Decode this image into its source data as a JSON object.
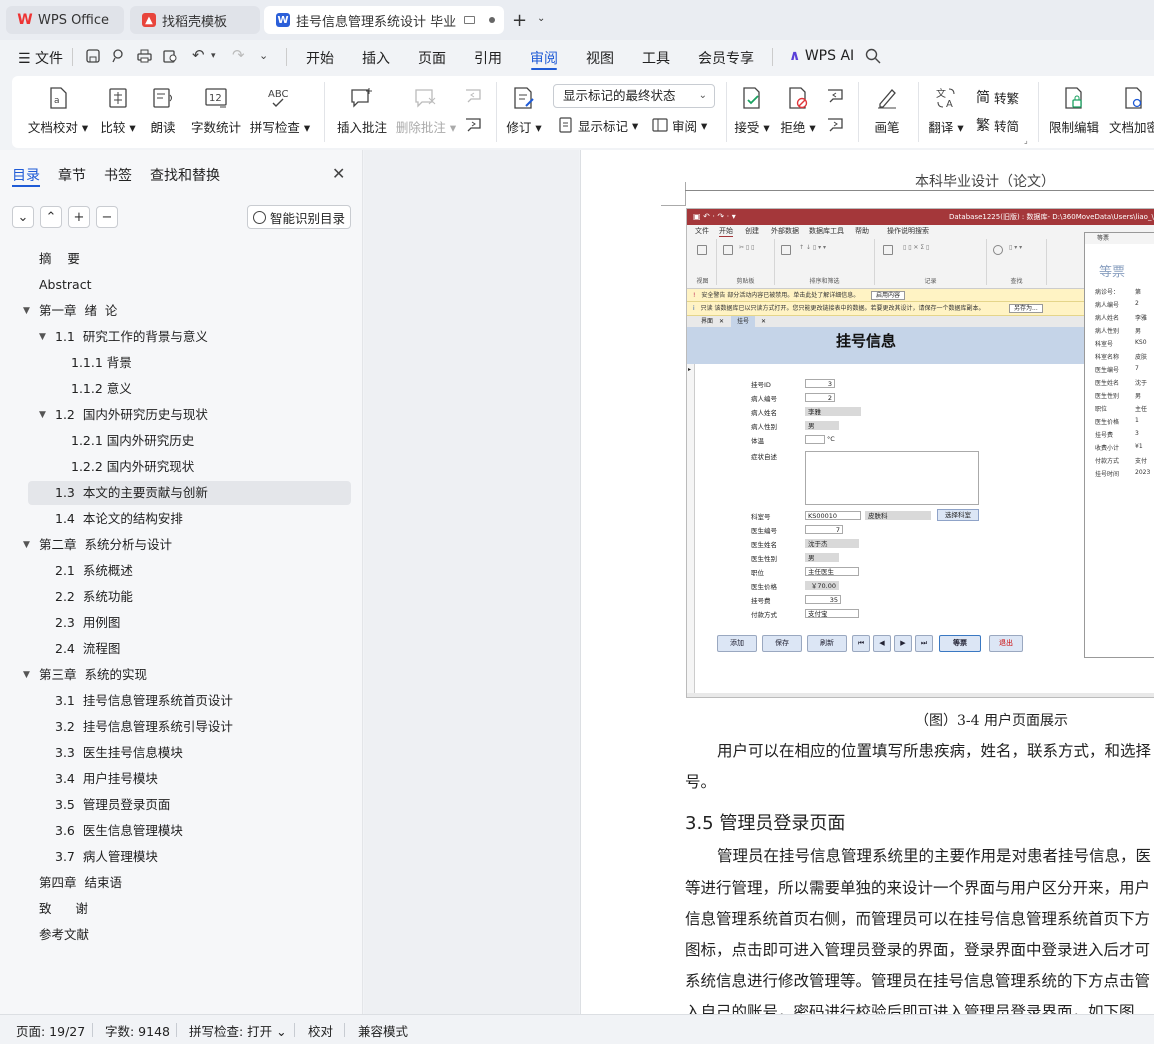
{
  "tabs": [
    {
      "label": "WPS Office",
      "icon": "wps-logo-icon"
    },
    {
      "label": "找稻壳模板",
      "icon": "docer-icon"
    },
    {
      "label": "挂号信息管理系统设计 毕业论",
      "icon": "wps-writer-icon"
    }
  ],
  "menu": {
    "file": "文件",
    "items": [
      "开始",
      "插入",
      "页面",
      "引用",
      "审阅",
      "视图",
      "工具",
      "会员专享"
    ],
    "active": "审阅",
    "ai": "WPS AI"
  },
  "ribbon": {
    "proofread": "文档校对",
    "compare": "比较",
    "read_aloud": "朗读",
    "word_count": "字数统计",
    "spellcheck": "拼写检查",
    "insert_comment": "插入批注",
    "delete_comment": "删除批注",
    "track": "修订",
    "markup_select": "显示标记的最终状态",
    "show_markup": "显示标记",
    "review": "审阅",
    "accept": "接受",
    "reject": "拒绝",
    "pen": "画笔",
    "translate": "翻译",
    "to_traditional": "转繁",
    "to_simplified": "转简",
    "restrict": "限制编辑",
    "encrypt": "文档加密"
  },
  "panel": {
    "tabs": [
      "目录",
      "章节",
      "书签",
      "查找和替换"
    ],
    "smart_toc": "智能识别目录",
    "toc": [
      {
        "text": "摘    要",
        "level": 1
      },
      {
        "text": "Abstract",
        "level": 1
      },
      {
        "text": "第一章  绪  论",
        "level": 1,
        "caret": true
      },
      {
        "text": "1.1  研究工作的背景与意义",
        "level": 2,
        "caret": true
      },
      {
        "text": "1.1.1 背景",
        "level": 3
      },
      {
        "text": "1.1.2 意义",
        "level": 3
      },
      {
        "text": "1.2  国内外研究历史与现状",
        "level": 2,
        "caret": true
      },
      {
        "text": "1.2.1 国内外研究历史",
        "level": 3
      },
      {
        "text": "1.2.2 国内外研究现状",
        "level": 3
      },
      {
        "text": "1.3  本文的主要贡献与创新",
        "level": 2,
        "selected": true
      },
      {
        "text": "1.4  本论文的结构安排",
        "level": 2
      },
      {
        "text": "第二章  系统分析与设计",
        "level": 1,
        "caret": true
      },
      {
        "text": "2.1  系统概述",
        "level": 2
      },
      {
        "text": "2.2  系统功能",
        "level": 2
      },
      {
        "text": "2.3  用例图",
        "level": 2
      },
      {
        "text": "2.4  流程图",
        "level": 2
      },
      {
        "text": "第三章  系统的实现",
        "level": 1,
        "caret": true
      },
      {
        "text": "3.1  挂号信息管理系统首页设计",
        "level": 2
      },
      {
        "text": "3.2  挂号信息管理系统引导设计",
        "level": 2
      },
      {
        "text": "3.3  医生挂号信息模块",
        "level": 2
      },
      {
        "text": "3.4  用户挂号模块",
        "level": 2
      },
      {
        "text": "3.5  管理员登录页面",
        "level": 2
      },
      {
        "text": "3.6  医生信息管理模块",
        "level": 2
      },
      {
        "text": "3.7  病人管理模块",
        "level": 2
      },
      {
        "text": "第四章  结束语",
        "level": 1
      },
      {
        "text": "致      谢",
        "level": 1
      },
      {
        "text": "参考文献",
        "level": 1
      }
    ]
  },
  "doc": {
    "header": "本科毕业设计（论文）",
    "caption": "（图）3-4  用户页面展示",
    "para1_l1": "用户可以在相应的位置填写所患疾病，姓名，联系方式，和选择",
    "para1_l2": "号。",
    "heading": "3.5  管理员登录页面",
    "para2": [
      "管理员在挂号信息管理系统里的主要作用是对患者挂号信息，医",
      "等进行管理，所以需要单独的来设计一个界面与用户区分开来，用户",
      "信息管理系统首页右侧，而管理员可以在挂号信息管理系统首页下方",
      "图标，点击即可进入管理员登录的界面，登录界面中登录进入后才可",
      "系统信息进行修改管理等。管理员在挂号信息管理系统的下方点击管",
      "入自己的账号，密码进行校验后即可进入管理员登录界面，如下图"
    ]
  },
  "access": {
    "titlebar": "Database1225(旧版) : 数据库- D:\\360MoveData\\Users\\liao_\\Desktop\\挂号",
    "tabs": [
      "文件",
      "开始",
      "创建",
      "外部数据",
      "数据库工具",
      "帮助",
      "操作说明搜索"
    ],
    "groups": [
      "视图",
      "剪贴板",
      "排序和筛选",
      "记录",
      "查找"
    ],
    "warn1": "安全警告  部分活动内容已被禁用。单击此处了解详细信息。",
    "warn1_btn": "启用内容",
    "warn2": "只读  该数据库已以只读方式打开。您只能更改链接表中的数据。若要更改其设计，请保存一个数据库副本。",
    "warn2_btn": "另存为...",
    "form_tabs": [
      "界面",
      "挂号"
    ],
    "form_title": "挂号信息",
    "fields": [
      {
        "label": "挂号ID",
        "value": "3"
      },
      {
        "label": "病人编号",
        "value": "2"
      },
      {
        "label": "病人姓名",
        "value": "李雅"
      },
      {
        "label": "病人性别",
        "value": "男"
      },
      {
        "label": "体温",
        "value": "",
        "unit": "°C"
      },
      {
        "label": "症状自述",
        "value": ""
      },
      {
        "label": "科室号",
        "value": "KS00010",
        "extra": "皮肤科"
      },
      {
        "label": "医生编号",
        "value": "7"
      },
      {
        "label": "医生姓名",
        "value": "沈于杰"
      },
      {
        "label": "医生性别",
        "value": "男"
      },
      {
        "label": "职位",
        "value": "主任医生"
      },
      {
        "label": "医生价格",
        "value": "￥70.00"
      },
      {
        "label": "挂号费",
        "value": "35"
      },
      {
        "label": "付款方式",
        "value": "支付宝"
      }
    ],
    "select_dept": "选择科室",
    "buttons": [
      "添加",
      "保存",
      "刷新",
      "等票",
      "退出"
    ],
    "receipt": {
      "bar": "等票",
      "title": "等票",
      "rows": [
        [
          "病诊号：",
          "第"
        ],
        [
          "病人编号",
          "2"
        ],
        [
          "病人姓名",
          "李雅"
        ],
        [
          "病人性别",
          "男"
        ],
        [
          "科室号",
          "KS0"
        ],
        [
          "科室名称",
          "皮肤"
        ],
        [
          "医生编号",
          "7"
        ],
        [
          "医生姓名",
          "沈于"
        ],
        [
          "医生性别",
          "男"
        ],
        [
          "职位",
          "主任"
        ],
        [
          "医生价格",
          "1"
        ],
        [
          "挂号费",
          "3"
        ],
        [
          "收费小计",
          "¥1"
        ],
        [
          "付款方式",
          "支付"
        ],
        [
          "挂号时间",
          "2023"
        ]
      ]
    }
  },
  "status": {
    "page": "页面: 19/27",
    "words": "字数: 9148",
    "spell": "拼写检查: 打开",
    "proof": "校对",
    "compat": "兼容模式"
  },
  "colors": {
    "accent": "#1f5bd6",
    "access_title": "#a4373a",
    "form_header": "#c5d4e8"
  }
}
